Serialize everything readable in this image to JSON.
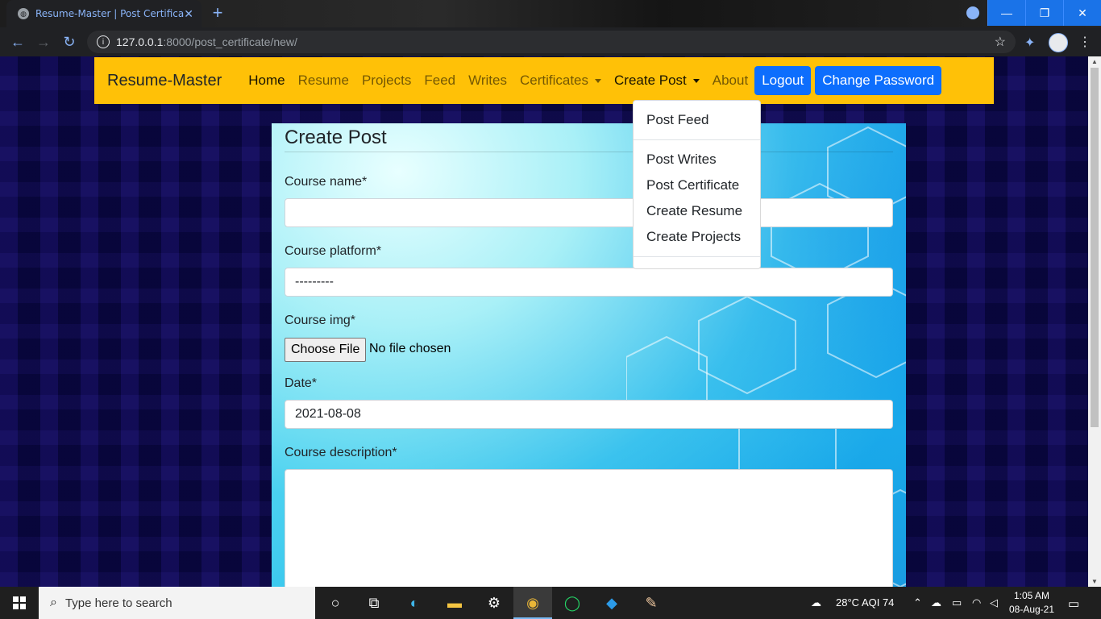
{
  "browser": {
    "tab_title": "Resume-Master | Post Certificate",
    "url_host": "127.0.0.1",
    "url_path": ":8000/post_certificate/new/"
  },
  "navbar": {
    "brand": "Resume-Master",
    "links": [
      "Home",
      "Resume",
      "Projects",
      "Feed",
      "Writes",
      "Certificates",
      "Create Post",
      "About"
    ],
    "logout": "Logout",
    "change_password": "Change Password"
  },
  "dropdown": {
    "items": [
      "Post Feed",
      "Post Writes",
      "Post Certificate",
      "Create Resume",
      "Create Projects"
    ]
  },
  "form": {
    "title": "Create Post",
    "course_name_label": "Course name*",
    "course_name_value": "",
    "platform_label": "Course platform*",
    "platform_value": "---------",
    "img_label": "Course img*",
    "choose_file": "Choose File",
    "no_file": "No file chosen",
    "date_label": "Date*",
    "date_value": "2021-08-08",
    "description_label": "Course description*",
    "description_value": ""
  },
  "taskbar": {
    "search_placeholder": "Type here to search",
    "weather": "28°C  AQI 74",
    "time": "1:05 AM",
    "date": "08-Aug-21"
  },
  "colors": {
    "navbar": "#ffc107",
    "primary_button": "#0d6efd"
  }
}
